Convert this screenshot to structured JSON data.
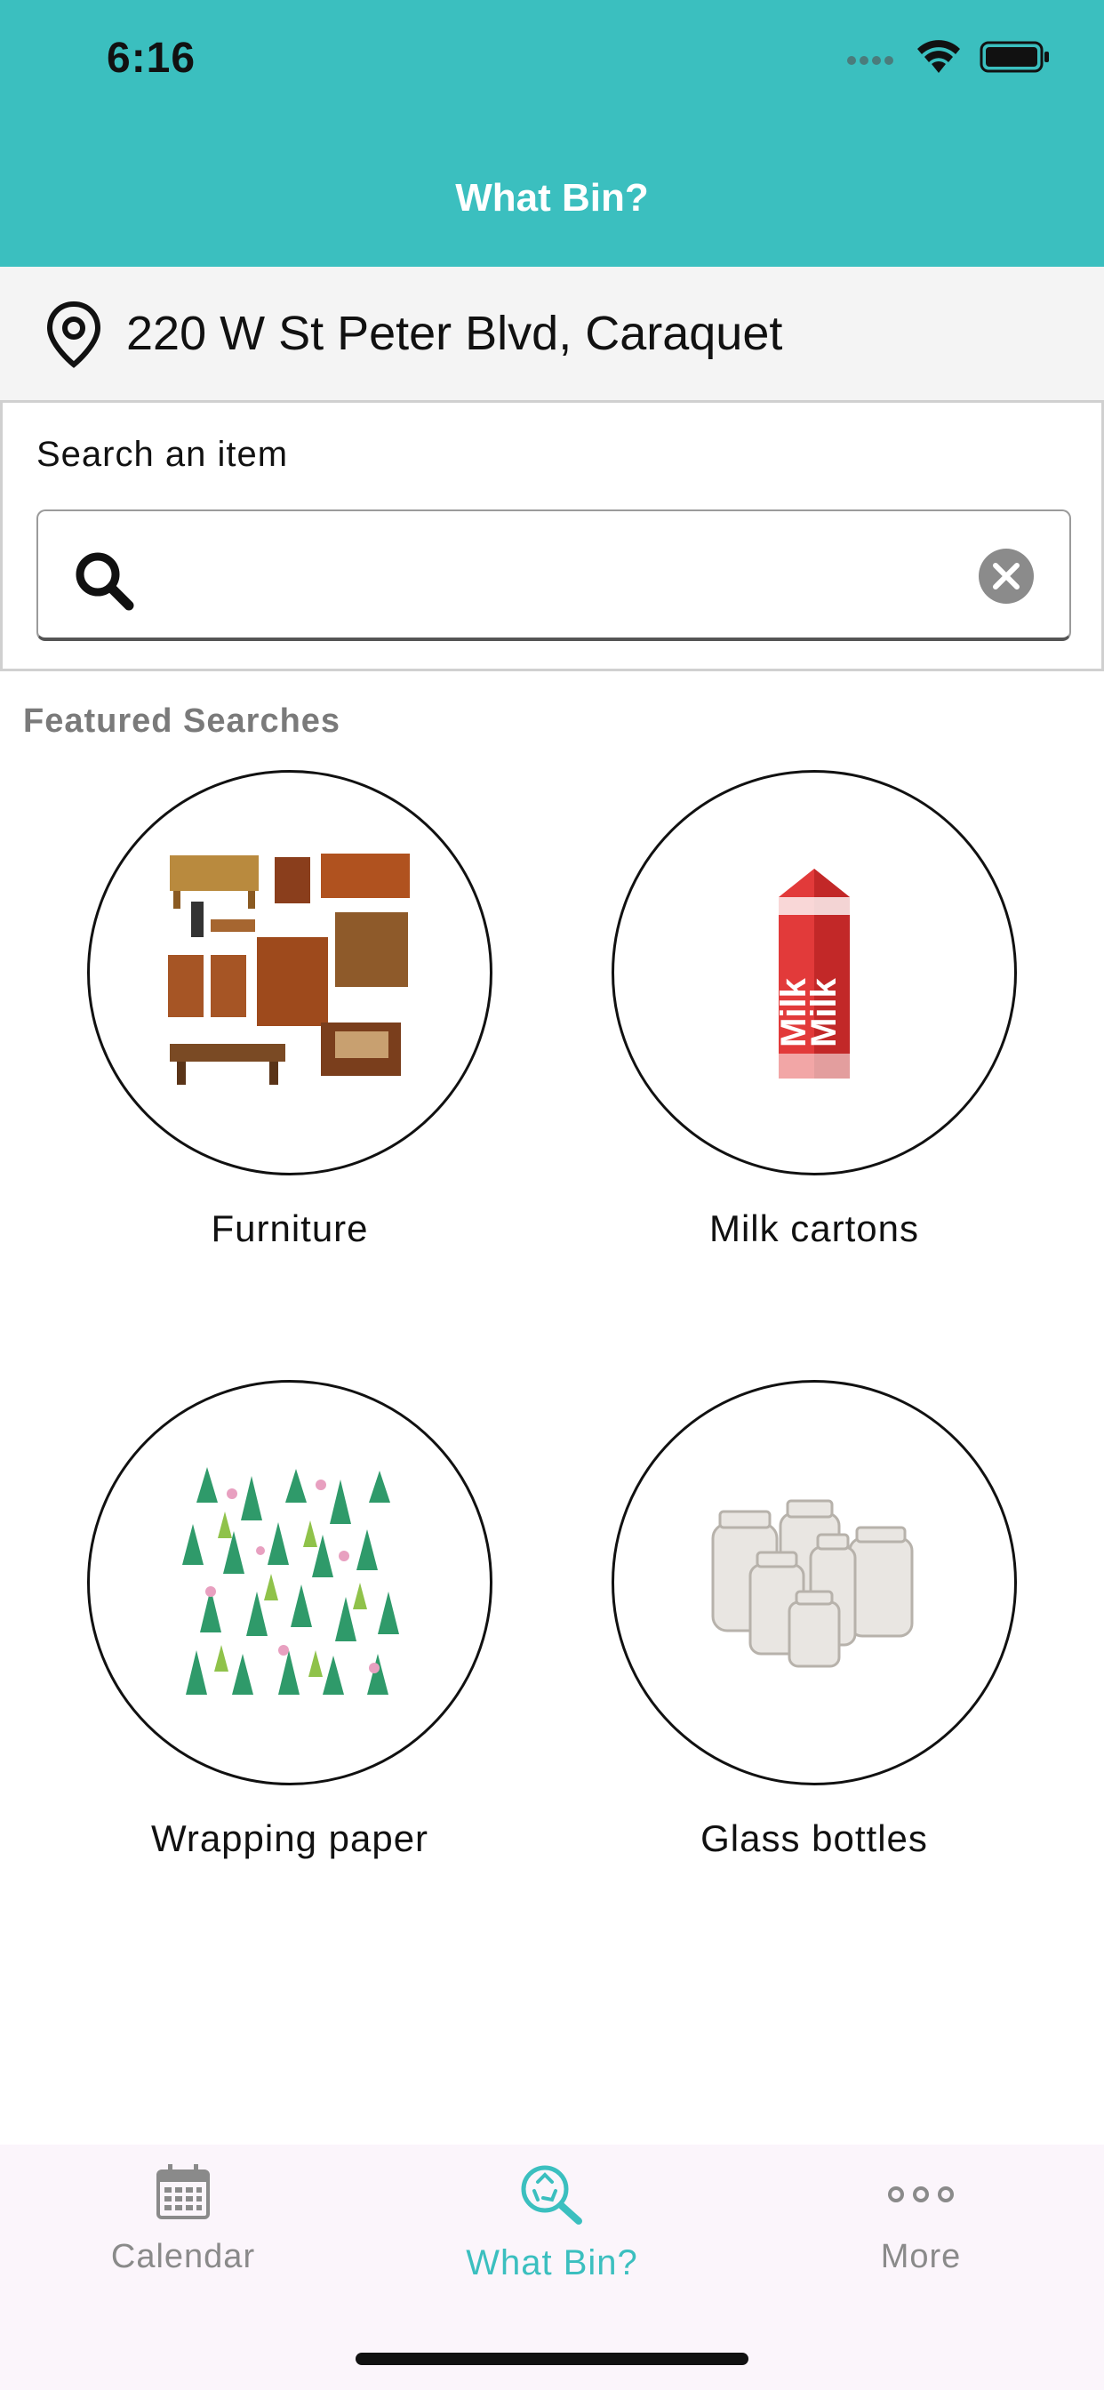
{
  "status_bar": {
    "time": "6:16"
  },
  "nav": {
    "title": "What Bin?"
  },
  "address": {
    "text": "220 W St Peter Blvd, Caraquet"
  },
  "search": {
    "label": "Search an item",
    "value": "",
    "placeholder": ""
  },
  "featured": {
    "heading": "Featured Searches",
    "items": [
      {
        "label": "Furniture"
      },
      {
        "label": "Milk cartons"
      },
      {
        "label": "Wrapping paper"
      },
      {
        "label": "Glass bottles"
      }
    ]
  },
  "milk_thumbnail": {
    "carton_text": "Milk"
  },
  "tabbar": {
    "items": [
      {
        "label": "Calendar",
        "icon": "calendar-icon",
        "active": false
      },
      {
        "label": "What Bin?",
        "icon": "recycle-search-icon",
        "active": true
      },
      {
        "label": "More",
        "icon": "more-dots-icon",
        "active": false
      }
    ]
  },
  "colors": {
    "accent": "#3bbfbf",
    "tab_inactive": "#8a8a8a",
    "tabbar_bg": "#fbf5fb"
  }
}
